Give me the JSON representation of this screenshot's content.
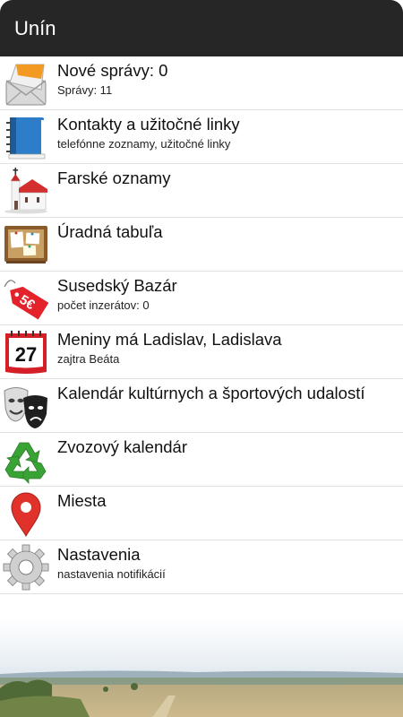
{
  "app_bar": {
    "title": "Unín"
  },
  "menu": [
    {
      "title": "Nové správy: 0",
      "subtitle": "Správy: 11",
      "icon": "envelope-icon"
    },
    {
      "title": "Kontakty a užitočné linky",
      "subtitle": "telefónne zoznamy, užitočné linky",
      "icon": "address-book-icon"
    },
    {
      "title": "Farské oznamy",
      "subtitle": "",
      "icon": "church-icon"
    },
    {
      "title": "Úradná tabuľa",
      "subtitle": "",
      "icon": "notice-board-icon"
    },
    {
      "title": "Susedský Bazár",
      "subtitle": "počet inzerátov: 0",
      "icon": "price-tag-icon",
      "icon_text": "5€"
    },
    {
      "title": "Meniny má Ladislav, Ladislava",
      "subtitle": "zajtra Beáta",
      "icon": "calendar-icon",
      "icon_text": "27"
    },
    {
      "title": "Kalendár kultúrnych a športových udalostí",
      "subtitle": "",
      "icon": "theater-masks-icon"
    },
    {
      "title": "Zvozový kalendár",
      "subtitle": "",
      "icon": "recycle-icon"
    },
    {
      "title": "Miesta",
      "subtitle": "",
      "icon": "map-pin-icon"
    },
    {
      "title": "Nastavenia",
      "subtitle": "nastavenia notifikácií",
      "icon": "gear-icon"
    }
  ],
  "colors": {
    "app_bar": "#262626",
    "divider": "#e2e2e2",
    "price_tag": "#e3222b",
    "calendar_red": "#d41f26",
    "recycle_green": "#3aa335",
    "pin_red": "#e0312a"
  }
}
